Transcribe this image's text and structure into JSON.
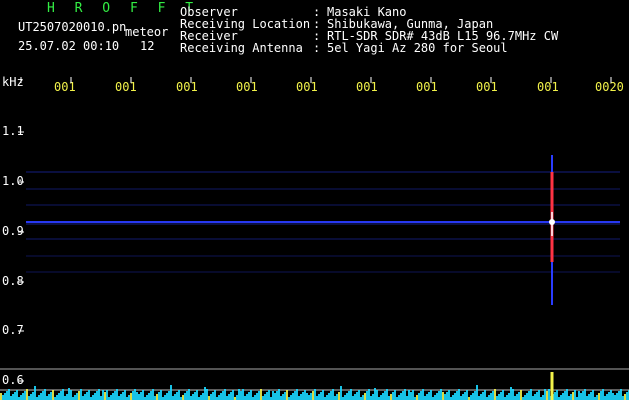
{
  "header": {
    "app_name": "H R O F F T",
    "file_name": "UT2507020010.pn",
    "mode": "meteor",
    "datetime": "25.07.02 00:10",
    "count": "12"
  },
  "station_info": [
    {
      "key": "Observer",
      "sep": ":",
      "value": "Masaki Kano"
    },
    {
      "key": "Receiving Location",
      "sep": ":",
      "value": "Shibukawa, Gunma, Japan"
    },
    {
      "key": "Receiver",
      "sep": ":",
      "value": "RTL-SDR SDR# 43dB L15 96.7MHz CW"
    },
    {
      "key": "Receiving Antenna",
      "sep": ":",
      "value": "5el Yagi Az 280 for Seoul"
    }
  ],
  "axis": {
    "unit_label": "kHz",
    "y_ticks": [
      "1.1",
      "1.0",
      "0.9",
      "0.8",
      "0.7",
      "0.6"
    ],
    "x_ticks": [
      "001",
      "001",
      "001",
      "001",
      "001",
      "001",
      "001",
      "001",
      "001",
      "0020"
    ]
  },
  "colors": {
    "background": "#000000",
    "header_green": "#33ee44",
    "label_yellow": "#f2f24a",
    "text_white": "#ffffff",
    "trace_blue": "#2a3cff",
    "meteor_red": "#ff3344",
    "baseline_cyan": "#19d7ff"
  }
}
